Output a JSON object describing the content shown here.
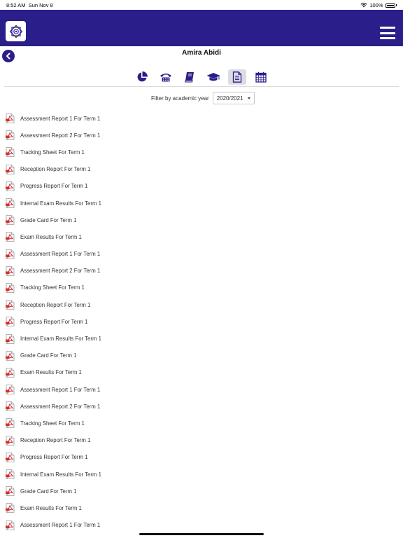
{
  "status_bar": {
    "time": "8:52 AM",
    "date": "Sun Nov 8",
    "battery": "100%"
  },
  "header": {
    "brand_color": "#2a1e8a",
    "logo_icon": "school-emblem-icon",
    "menu_icon": "hamburger-menu-icon"
  },
  "student": {
    "name": "Amira Abidi"
  },
  "tabs": [
    {
      "icon": "pie-chart-icon",
      "active": false
    },
    {
      "icon": "phone-icon",
      "active": false
    },
    {
      "icon": "book-icon",
      "active": false
    },
    {
      "icon": "graduation-cap-icon",
      "active": false
    },
    {
      "icon": "document-icon",
      "active": true
    },
    {
      "icon": "calendar-icon",
      "active": false
    }
  ],
  "filter": {
    "label": "Filter by academic year",
    "selected": "2020/2021"
  },
  "reports": [
    "Assessment Report 1 For Term 1",
    "Assessment Report 2 For Term 1",
    "Tracking Sheet For Term 1",
    "Reception Report For Term 1",
    "Progress Report For Term 1",
    "Internal Exam Results For Term 1",
    "Grade Card For Term 1",
    "Exam Results For Term 1",
    "Assessment Report 1 For Term 1",
    "Assessment Report 2 For Term 1",
    "Tracking Sheet For Term 1",
    "Reception Report For Term 1",
    "Progress Report For Term 1",
    "Internal Exam Results For Term 1",
    "Grade Card For Term 1",
    "Exam Results For Term 1",
    "Assessment Report 1 For Term 1",
    "Assessment Report 2 For Term 1",
    "Tracking Sheet For Term 1",
    "Reception Report For Term 1",
    "Progress Report For Term 1",
    "Internal Exam Results For Term 1",
    "Grade Card For Term 1",
    "Exam Results For Term 1",
    "Assessment Report 1 For Term 1"
  ]
}
